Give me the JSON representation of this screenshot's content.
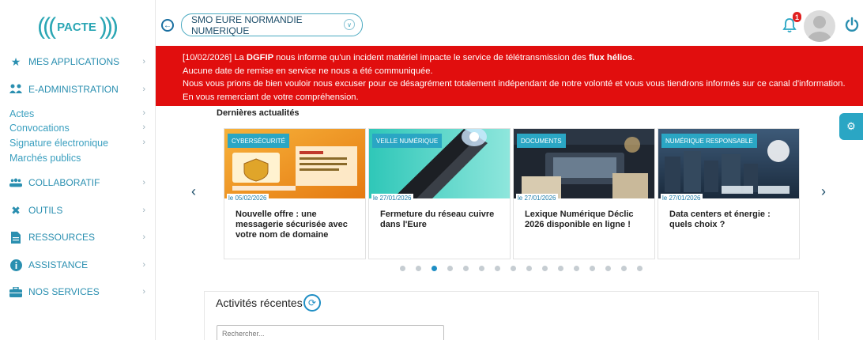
{
  "logo": {
    "text": "PACTE",
    "wave_left": "(((",
    "wave_right": ")))"
  },
  "sidebar": {
    "items": [
      {
        "label": "MES APPLICATIONS",
        "icon": "star-icon"
      },
      {
        "label": "E-ADMINISTRATION",
        "icon": "people-icon"
      },
      {
        "label": "COLLABORATIF",
        "icon": "group-icon"
      },
      {
        "label": "OUTILS",
        "icon": "tools-icon"
      },
      {
        "label": "RESSOURCES",
        "icon": "document-icon"
      },
      {
        "label": "ASSISTANCE",
        "icon": "info-icon"
      },
      {
        "label": "NOS SERVICES",
        "icon": "briefcase-icon"
      }
    ],
    "subitems": [
      {
        "label": "Actes"
      },
      {
        "label": "Convocations"
      },
      {
        "label": "Signature électronique"
      },
      {
        "label": "Marchés publics"
      }
    ]
  },
  "header": {
    "organization": "SMO EURE NORMANDIE NUMERIQUE",
    "notification_count": "1"
  },
  "alert": {
    "line1_a": "[10/02/2026] La ",
    "line1_b": "DGFIP",
    "line1_c": " nous informe qu'un incident matériel impacte le service de télétransmission des ",
    "line1_d": "flux hélios",
    "line1_e": ".",
    "line2": "Aucune date de remise en service ne nous a été communiquée.",
    "line3": "Nous vous prions de bien vouloir nous excuser pour ce désagrément totalement indépendant de notre volonté et vous vous tiendrons informés sur ce canal d'information.",
    "line4": "En vous remerciant de votre compréhension."
  },
  "news": {
    "title": "Dernières actualités",
    "cards": [
      {
        "tag": "CYBERSÉCURITÉ",
        "date": "le 05/02/2026",
        "headline": "Nouvelle offre : une messagerie sécurisée avec votre nom de domaine"
      },
      {
        "tag": "VEILLE NUMÉRIQUE",
        "date": "le 27/01/2026",
        "headline": "Fermeture du réseau cuivre dans l'Eure"
      },
      {
        "tag": "DOCUMENTS",
        "date": "le 27/01/2026",
        "headline": "Lexique Numérique Déclic 2026 disponible en ligne !"
      },
      {
        "tag": "NUMÉRIQUE RESPONSABLE",
        "date": "le 27/01/2026",
        "headline": "Data centers et énergie : quels choix ?"
      }
    ],
    "dot_count": 16,
    "active_dot": 2
  },
  "activity": {
    "title": "Activités récentes",
    "search_placeholder": "Rechercher..."
  },
  "colors": {
    "alert_red": "#e10e0e",
    "accent": "#2aa6c4",
    "menu_text": "#2a8fb0"
  }
}
